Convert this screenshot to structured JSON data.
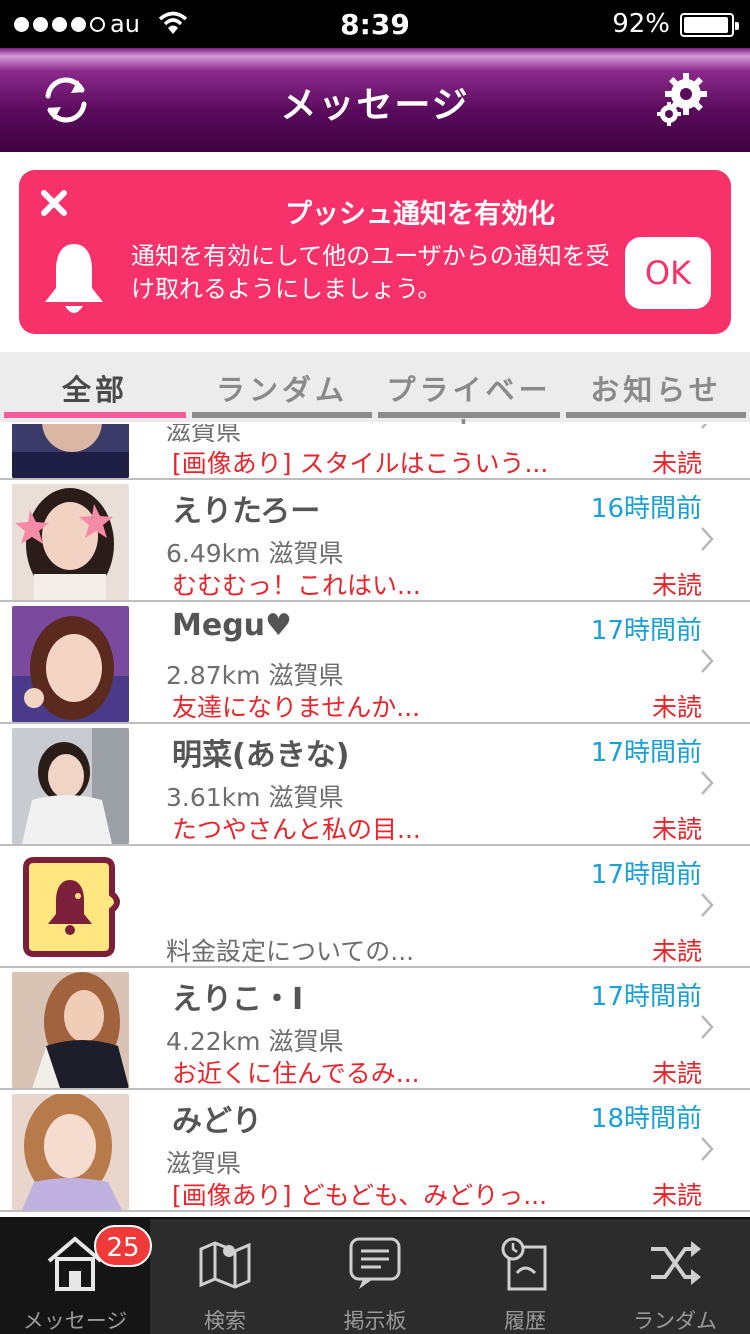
{
  "status_bar": {
    "carrier": "au",
    "time": "8:39",
    "battery": "92%"
  },
  "nav": {
    "title": "メッセージ"
  },
  "push_banner": {
    "title": "プッシュ通知を有効化",
    "body": "通知を有効にして他のユーザからの通知を受け取れるようにしましょう。",
    "ok_label": "OK",
    "color": "#f7316a"
  },
  "tabs": [
    {
      "label": "全部",
      "active": true
    },
    {
      "label": "ランダム",
      "active": false
    },
    {
      "label": "プライベート",
      "active": false
    },
    {
      "label": "お知らせ",
      "active": false
    }
  ],
  "messages": [
    {
      "name": "",
      "time": "",
      "location": "滋賀県",
      "preview": "[画像あり] スタイルはこういう...",
      "status": "未読"
    },
    {
      "name": "えりたろー",
      "time": "16時間前",
      "location": "6.49km 滋賀県",
      "preview": "むむむっ！これはい...",
      "status": "未読"
    },
    {
      "name": "Megu♥",
      "time": "17時間前",
      "location": "2.87km 滋賀県",
      "preview": "友達になりませんか...",
      "status": "未読"
    },
    {
      "name": "明菜(あきな)",
      "time": "17時間前",
      "location": "3.61km 滋賀県",
      "preview": "たつやさんと私の目...",
      "status": "未読"
    },
    {
      "name": "",
      "time": "17時間前",
      "location": "",
      "preview": "料金設定についての...",
      "status": "未読"
    },
    {
      "name": "えりこ・I",
      "time": "17時間前",
      "location": "4.22km 滋賀県",
      "preview": "お近くに住んでるみ...",
      "status": "未読"
    },
    {
      "name": "みどり",
      "time": "18時間前",
      "location": "滋賀県",
      "preview": "[画像あり] どもども、みどりっ...",
      "status": "未読"
    }
  ],
  "bottom_tabs": [
    {
      "label": "メッセージ",
      "icon": "home-icon",
      "badge": "25",
      "active": true
    },
    {
      "label": "検索",
      "icon": "map-icon",
      "active": false
    },
    {
      "label": "掲示板",
      "icon": "board-icon",
      "active": false
    },
    {
      "label": "履歴",
      "icon": "history-icon",
      "active": false
    },
    {
      "label": "ランダム",
      "icon": "shuffle-icon",
      "active": false
    }
  ],
  "colors": {
    "accent_pink": "#f35c96",
    "time_blue": "#1aa0d4",
    "unread_red": "#e6262c"
  }
}
